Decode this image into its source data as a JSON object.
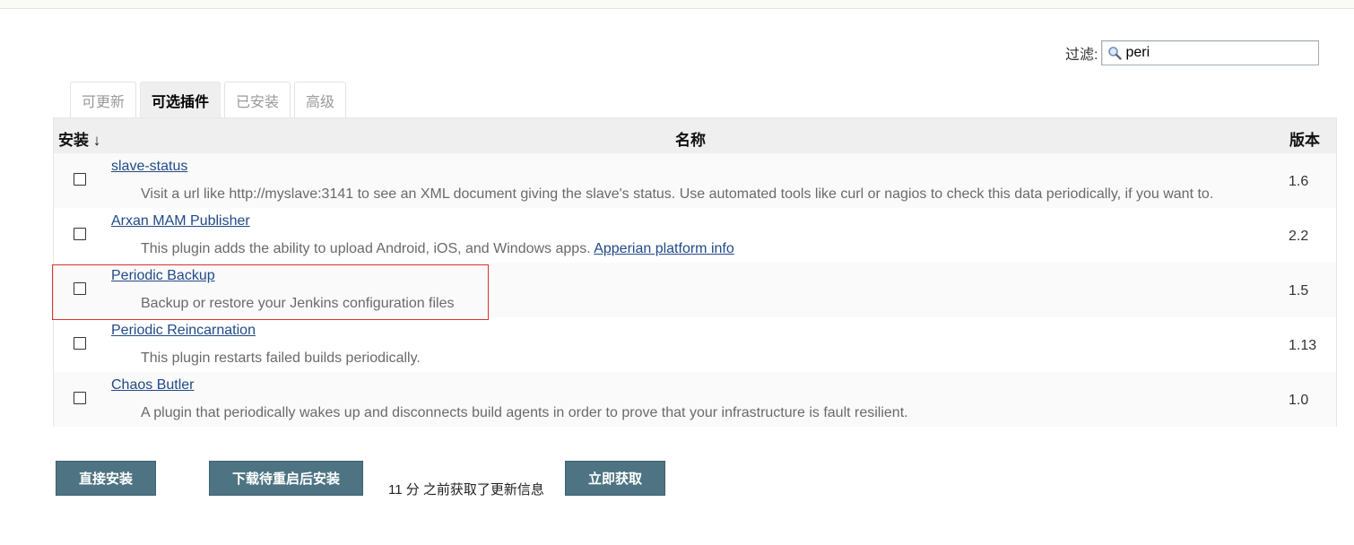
{
  "filter": {
    "label": "过滤:",
    "value": "peri"
  },
  "tabs": [
    {
      "label": "可更新",
      "active": false
    },
    {
      "label": "可选插件",
      "active": true
    },
    {
      "label": "已安装",
      "active": false
    },
    {
      "label": "高级",
      "active": false
    }
  ],
  "table": {
    "headers": {
      "install": "安装 ↓",
      "name": "名称",
      "version": "版本"
    },
    "rows": [
      {
        "name": "slave-status",
        "description": "Visit a url like http://myslave:3141 to see an XML document giving the slave's status. Use automated tools like curl or nagios to check this data periodically, if you want to.",
        "link": "",
        "version": "1.6",
        "checked": false
      },
      {
        "name": "Arxan MAM Publisher",
        "description": "This plugin adds the ability to upload Android, iOS, and Windows apps. ",
        "link": "Apperian platform info",
        "version": "2.2",
        "checked": false
      },
      {
        "name": "Periodic Backup",
        "description": "Backup or restore your Jenkins configuration files",
        "link": "",
        "version": "1.5",
        "checked": false
      },
      {
        "name": "Periodic Reincarnation",
        "description": "This plugin restarts failed builds periodically.",
        "link": "",
        "version": "1.13",
        "checked": false
      },
      {
        "name": "Chaos Butler",
        "description": "A plugin that periodically wakes up and disconnects build agents in order to prove that your infrastructure is fault resilient.",
        "link": "",
        "version": "1.0",
        "checked": false
      }
    ]
  },
  "actions": {
    "install_now": "直接安装",
    "download_restart": "下载待重启后安装",
    "status_text": "11 分 之前获取了更新信息",
    "fetch_now": "立即获取"
  },
  "colors": {
    "highlight": "#e03030",
    "button": "#4e7483",
    "link": "#204a87"
  }
}
